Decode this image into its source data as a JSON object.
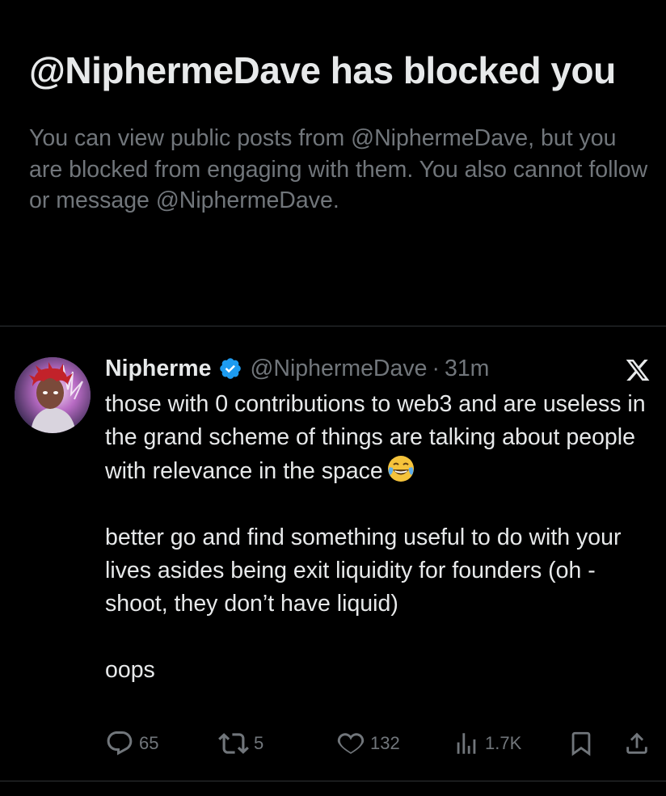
{
  "blocked": {
    "title": "@NiphermeDave has blocked you",
    "description": "You can view public posts from @NiphermeDave, but you are blocked from engaging with them. You also cannot follow or message @NiphermeDave."
  },
  "tweet": {
    "display_name": "Nipherme",
    "handle": "@NiphermeDave",
    "separator": "·",
    "time": "31m",
    "paragraphs": [
      "those with 0 contributions to web3 and are useless in the grand scheme of things are talking about people with relevance in the space",
      "better go and find something useful to do with your lives asides being exit liquidity for founders (oh - shoot, they don’t have liquid)",
      "oops"
    ],
    "emoji": "face-with-tears-of-joy",
    "actions": {
      "replies": "65",
      "reposts": "5",
      "likes": "132",
      "views": "1.7K"
    }
  },
  "colors": {
    "background": "#000000",
    "text": "#e7e9ea",
    "muted": "#71767b",
    "divider": "#2f3336",
    "verified": "#1d9bf0"
  },
  "icons": {
    "brand": "x-logo",
    "verified": "verified-badge-icon"
  }
}
